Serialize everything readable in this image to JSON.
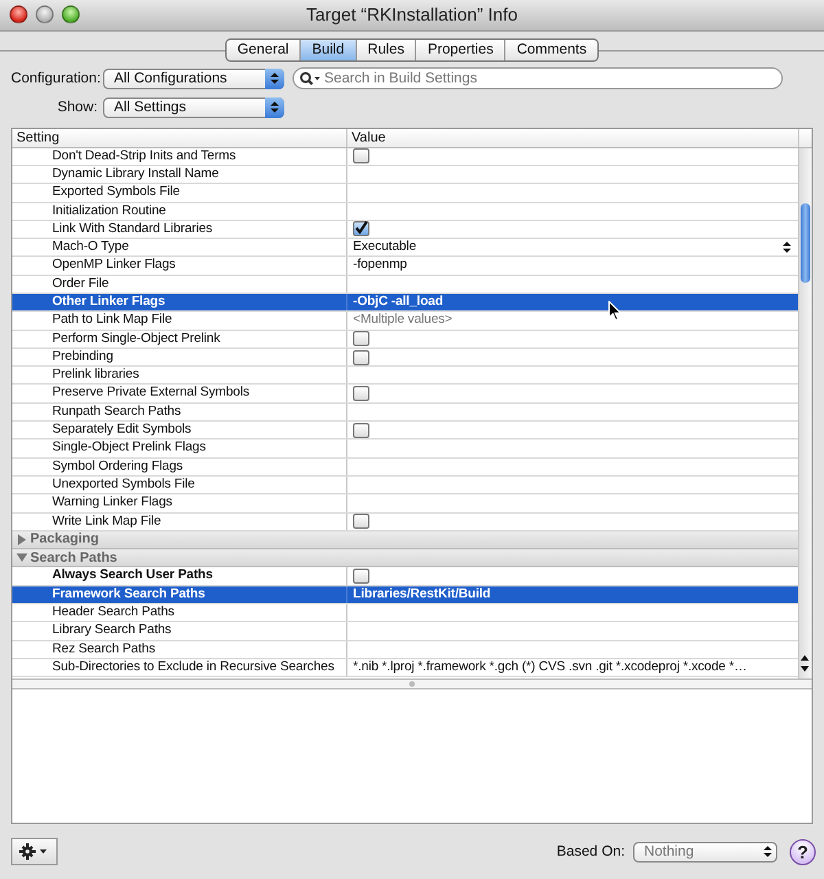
{
  "window": {
    "title": "Target “RKInstallation” Info"
  },
  "tabs": [
    {
      "label": "General",
      "selected": false
    },
    {
      "label": "Build",
      "selected": true
    },
    {
      "label": "Rules",
      "selected": false
    },
    {
      "label": "Properties",
      "selected": false
    },
    {
      "label": "Comments",
      "selected": false
    }
  ],
  "configuration": {
    "label": "Configuration:",
    "value": "All Configurations"
  },
  "search": {
    "placeholder": "Search in Build Settings"
  },
  "show": {
    "label": "Show:",
    "value": "All Settings"
  },
  "table": {
    "columns": [
      "Setting",
      "Value"
    ],
    "rows": [
      {
        "kind": "checkbox",
        "setting": "Don't Dead-Strip Inits and Terms",
        "checked": false,
        "selected": false,
        "bold": false
      },
      {
        "kind": "empty",
        "setting": "Dynamic Library Install Name",
        "selected": false,
        "bold": false
      },
      {
        "kind": "empty",
        "setting": "Exported Symbols File",
        "selected": false,
        "bold": false
      },
      {
        "kind": "empty",
        "setting": "Initialization Routine",
        "selected": false,
        "bold": false
      },
      {
        "kind": "checkbox",
        "setting": "Link With Standard Libraries",
        "checked": true,
        "selected": false,
        "bold": false
      },
      {
        "kind": "popup",
        "setting": "Mach-O Type",
        "value": "Executable",
        "selected": false,
        "bold": false
      },
      {
        "kind": "text",
        "setting": "OpenMP Linker Flags",
        "value": "-fopenmp",
        "selected": false,
        "bold": false
      },
      {
        "kind": "empty",
        "setting": "Order File",
        "selected": false,
        "bold": false
      },
      {
        "kind": "text",
        "setting": "Other Linker Flags",
        "value": "-ObjC -all_load",
        "selected": true,
        "bold": true
      },
      {
        "kind": "placeholder",
        "setting": "Path to Link Map File",
        "value": "<Multiple values>",
        "selected": false,
        "bold": false
      },
      {
        "kind": "checkbox",
        "setting": "Perform Single-Object Prelink",
        "checked": false,
        "selected": false,
        "bold": false
      },
      {
        "kind": "checkbox",
        "setting": "Prebinding",
        "checked": false,
        "selected": false,
        "bold": false
      },
      {
        "kind": "empty",
        "setting": "Prelink libraries",
        "selected": false,
        "bold": false
      },
      {
        "kind": "checkbox",
        "setting": "Preserve Private External Symbols",
        "checked": false,
        "selected": false,
        "bold": false
      },
      {
        "kind": "empty",
        "setting": "Runpath Search Paths",
        "selected": false,
        "bold": false
      },
      {
        "kind": "checkbox",
        "setting": "Separately Edit Symbols",
        "checked": false,
        "selected": false,
        "bold": false
      },
      {
        "kind": "empty",
        "setting": "Single-Object Prelink Flags",
        "selected": false,
        "bold": false
      },
      {
        "kind": "empty",
        "setting": "Symbol Ordering Flags",
        "selected": false,
        "bold": false
      },
      {
        "kind": "empty",
        "setting": "Unexported Symbols File",
        "selected": false,
        "bold": false
      },
      {
        "kind": "empty",
        "setting": "Warning Linker Flags",
        "selected": false,
        "bold": false
      },
      {
        "kind": "checkbox",
        "setting": "Write Link Map File",
        "checked": false,
        "selected": false,
        "bold": false
      },
      {
        "kind": "group",
        "setting": "Packaging",
        "expanded": false
      },
      {
        "kind": "group",
        "setting": "Search Paths",
        "expanded": true
      },
      {
        "kind": "checkbox",
        "setting": "Always Search User Paths",
        "checked": false,
        "selected": false,
        "bold": true
      },
      {
        "kind": "text",
        "setting": "Framework Search Paths",
        "value": "Libraries/RestKit/Build",
        "selected": true,
        "bold": true
      },
      {
        "kind": "empty",
        "setting": "Header Search Paths",
        "selected": false,
        "bold": false
      },
      {
        "kind": "empty",
        "setting": "Library Search Paths",
        "selected": false,
        "bold": false
      },
      {
        "kind": "empty",
        "setting": "Rez Search Paths",
        "selected": false,
        "bold": false
      },
      {
        "kind": "text",
        "setting": "Sub-Directories to Exclude in Recursive Searches",
        "value": "*.nib *.lproj *.framework *.gch (*) CVS .svn .git *.xcodeproj *.xcode *…",
        "selected": false,
        "bold": false
      }
    ]
  },
  "based_on": {
    "label": "Based On:",
    "value": "Nothing",
    "disabled": true
  },
  "help_button": {
    "label": "?"
  }
}
